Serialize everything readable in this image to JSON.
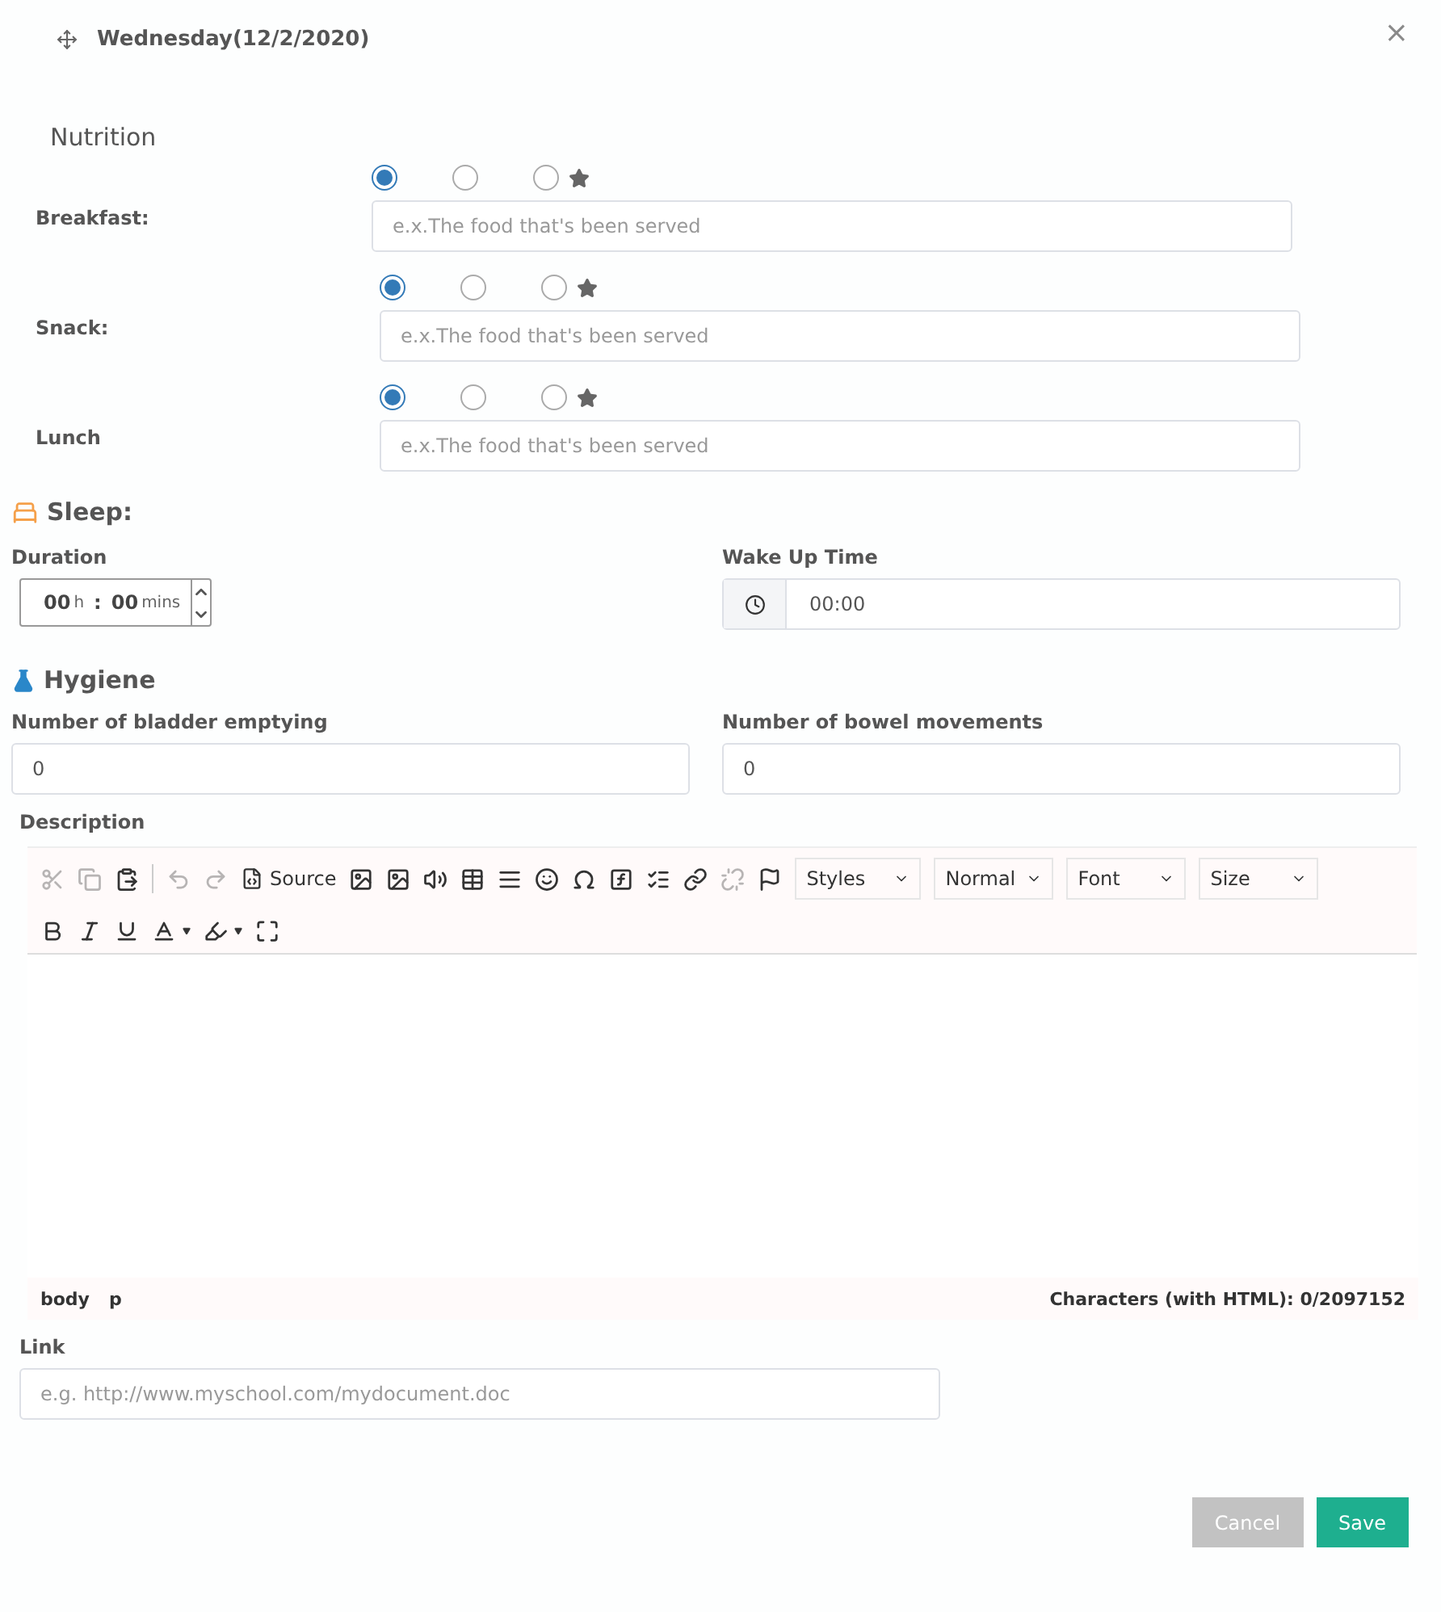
{
  "dialog": {
    "title": "Wednesday(12/2/2020)",
    "close": "×"
  },
  "nutrition": {
    "heading": "Nutrition",
    "meals": [
      {
        "label": "Breakfast:",
        "placeholder": "e.x.The food that's been served",
        "options": [
          {
            "kind": "plain",
            "selected": true
          },
          {
            "kind": "plain",
            "selected": false
          },
          {
            "kind": "star",
            "selected": false
          }
        ]
      },
      {
        "label": "Snack:",
        "placeholder": "e.x.The food that's been served",
        "options": [
          {
            "kind": "plain",
            "selected": true
          },
          {
            "kind": "plain",
            "selected": false
          },
          {
            "kind": "star",
            "selected": false
          }
        ]
      },
      {
        "label": "Lunch",
        "placeholder": "e.x.The food that's been served",
        "options": [
          {
            "kind": "plain",
            "selected": true
          },
          {
            "kind": "plain",
            "selected": false
          },
          {
            "kind": "star",
            "selected": false
          }
        ]
      }
    ]
  },
  "sleep": {
    "heading": "Sleep:",
    "duration": {
      "label": "Duration",
      "hours": "00",
      "hours_unit": "h",
      "separator": ":",
      "minutes": "00",
      "minutes_unit": "mins"
    },
    "wake_up": {
      "label": "Wake Up Time",
      "value": "00:00"
    }
  },
  "hygiene": {
    "heading": "Hygiene",
    "bladder": {
      "label": "Number of bladder emptying",
      "value": "0"
    },
    "bowel": {
      "label": "Number of bowel movements",
      "value": "0"
    }
  },
  "description": {
    "label": "Description",
    "toolbar": [
      {
        "kind": "cut",
        "disabled": true
      },
      {
        "kind": "copy",
        "disabled": true
      },
      {
        "kind": "paste",
        "disabled": false
      },
      {
        "kind": "separator"
      },
      {
        "kind": "undo",
        "disabled": true
      },
      {
        "kind": "redo",
        "disabled": true
      },
      {
        "kind": "source",
        "label": "Source",
        "disabled": false
      },
      {
        "kind": "image",
        "disabled": false
      },
      {
        "kind": "image",
        "disabled": false
      },
      {
        "kind": "audio",
        "disabled": false
      },
      {
        "kind": "table",
        "disabled": false
      },
      {
        "kind": "rule",
        "disabled": false
      },
      {
        "kind": "smiley",
        "disabled": false
      },
      {
        "kind": "omega",
        "disabled": false
      },
      {
        "kind": "formula",
        "disabled": false
      },
      {
        "kind": "list",
        "disabled": false
      },
      {
        "kind": "link",
        "disabled": false
      },
      {
        "kind": "unlink",
        "disabled": true
      },
      {
        "kind": "flag",
        "disabled": false
      },
      {
        "kind": "dropdown",
        "label": "Styles"
      },
      {
        "kind": "dropdown",
        "label": "Normal"
      },
      {
        "kind": "dropdown",
        "label": "Font"
      },
      {
        "kind": "dropdown",
        "label": "Size"
      },
      {
        "kind": "bold",
        "disabled": false
      },
      {
        "kind": "italic",
        "disabled": false
      },
      {
        "kind": "underline",
        "disabled": false
      },
      {
        "kind": "textcolor",
        "disabled": false
      },
      {
        "kind": "bgcolor",
        "disabled": false
      },
      {
        "kind": "maximize",
        "disabled": false
      }
    ],
    "path": [
      "body",
      "p"
    ],
    "counter": "Characters (with HTML): 0/2097152"
  },
  "link": {
    "label": "Link",
    "placeholder": "e.g. http://www.myschool.com/mydocument.doc"
  },
  "buttons": [
    {
      "kind": "cancel",
      "label": "Cancel"
    },
    {
      "kind": "save",
      "label": "Save"
    }
  ]
}
